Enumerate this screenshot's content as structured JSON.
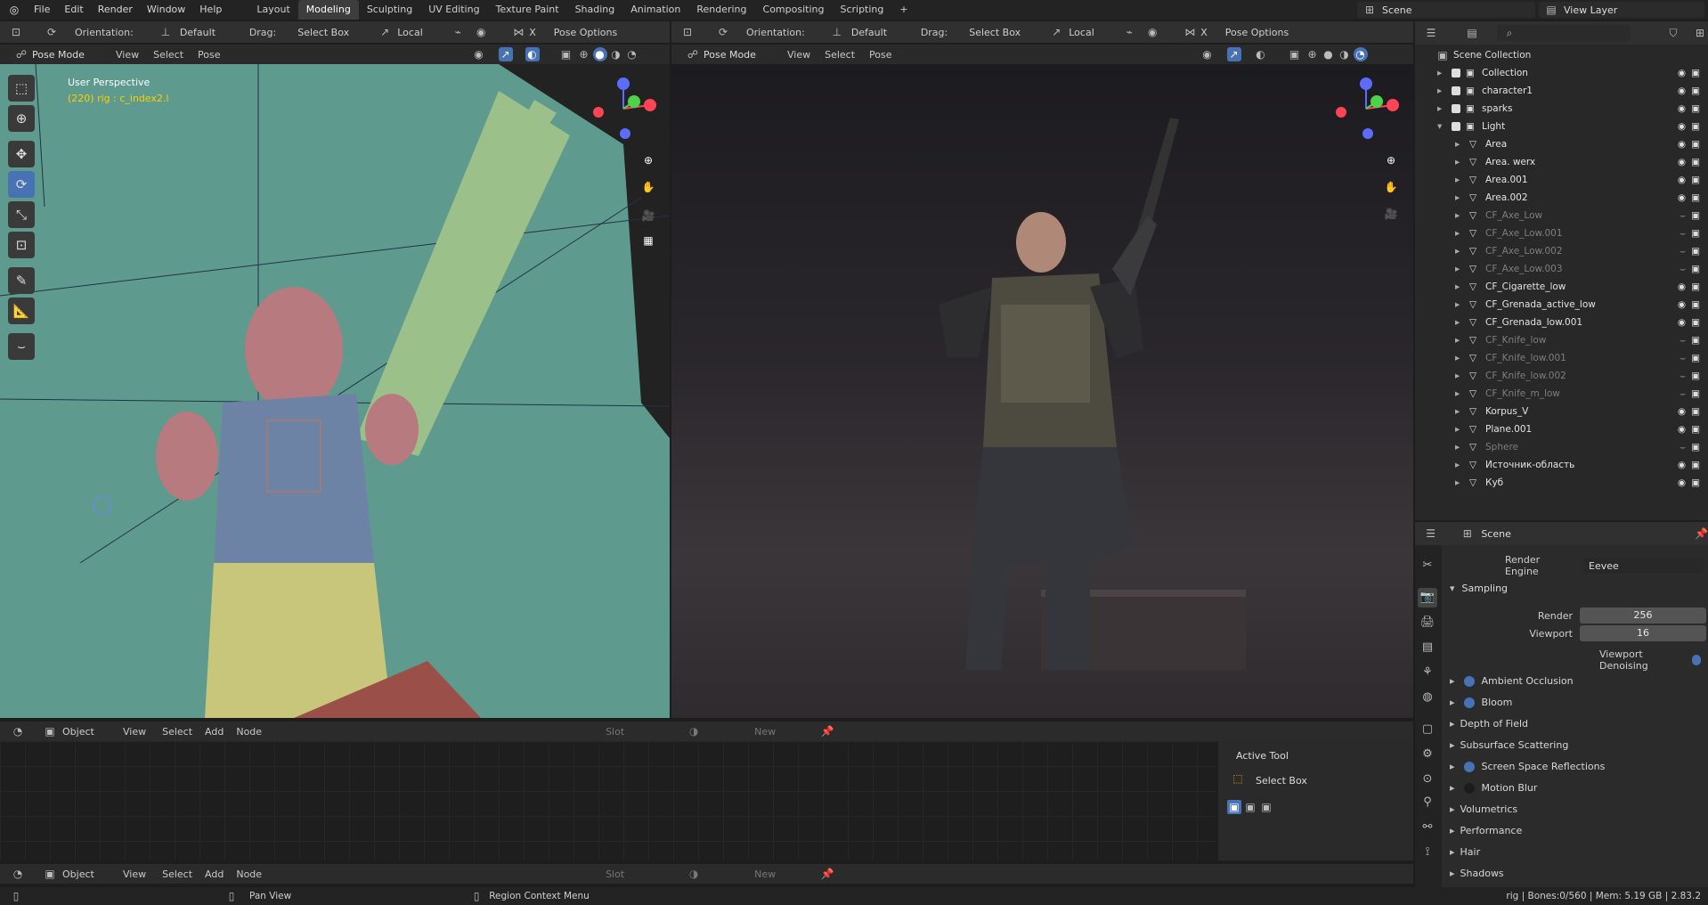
{
  "topbar": {
    "menus": [
      "File",
      "Edit",
      "Render",
      "Window",
      "Help"
    ],
    "workspaces": [
      "Layout",
      "Modeling",
      "Sculpting",
      "UV Editing",
      "Texture Paint",
      "Shading",
      "Animation",
      "Rendering",
      "Compositing",
      "Scripting"
    ],
    "active_workspace": "Modeling",
    "add_tab": "+",
    "scene_label": "Scene",
    "view_layer_label": "View Layer"
  },
  "viewport_header": {
    "orientation_label": "Orientation:",
    "orientation_value": "Default",
    "drag_label": "Drag:",
    "drag_value": "Select Box",
    "transform_value": "Local",
    "axis_label": "X",
    "pose_options": "Pose Options",
    "mode": "Pose Mode",
    "menus": [
      "View",
      "Select",
      "Pose"
    ]
  },
  "left_viewport": {
    "perspective_label": "User Perspective",
    "context_label": "(220) rig : c_index2.l",
    "bg_color": "#5f9a8e"
  },
  "node_editor": {
    "object_label": "Object",
    "menus": [
      "View",
      "Select",
      "Add",
      "Node"
    ],
    "slot_label": "Slot",
    "new_label": "New",
    "active_tool_title": "Active Tool",
    "active_tool_name": "Select Box"
  },
  "outliner": {
    "root": "Scene Collection",
    "items": [
      {
        "name": "Collection",
        "dim": false
      },
      {
        "name": "character1",
        "dim": false
      },
      {
        "name": "sparks",
        "dim": false
      },
      {
        "name": "Light",
        "dim": false
      },
      {
        "name": "Area",
        "dim": false
      },
      {
        "name": "Area. werx",
        "dim": false
      },
      {
        "name": "Area.001",
        "dim": false
      },
      {
        "name": "Area.002",
        "dim": false
      },
      {
        "name": "CF_Axe_Low",
        "dim": true
      },
      {
        "name": "CF_Axe_Low.001",
        "dim": true
      },
      {
        "name": "CF_Axe_Low.002",
        "dim": true
      },
      {
        "name": "CF_Axe_Low.003",
        "dim": true
      },
      {
        "name": "CF_Cigarette_low",
        "dim": false
      },
      {
        "name": "CF_Grenada_active_low",
        "dim": false
      },
      {
        "name": "CF_Grenada_low.001",
        "dim": false
      },
      {
        "name": "CF_Knife_low",
        "dim": true
      },
      {
        "name": "CF_Knife_low.001",
        "dim": true
      },
      {
        "name": "CF_Knife_low.002",
        "dim": true
      },
      {
        "name": "CF_Knife_m_low",
        "dim": true
      },
      {
        "name": "Korpus_V",
        "dim": false
      },
      {
        "name": "Plane.001",
        "dim": false
      },
      {
        "name": "Sphere",
        "dim": true
      },
      {
        "name": "Источник-область",
        "dim": false
      },
      {
        "name": "Куб",
        "dim": false
      }
    ]
  },
  "properties": {
    "context": "Scene",
    "render_engine_label": "Render Engine",
    "render_engine_value": "Eevee",
    "sampling_label": "Sampling",
    "render_label": "Render",
    "render_value": "256",
    "viewport_label": "Viewport",
    "viewport_value": "16",
    "viewport_denoising": "Viewport Denoising",
    "panels": [
      {
        "label": "Ambient Occlusion",
        "toggle": "on"
      },
      {
        "label": "Bloom",
        "toggle": "on"
      },
      {
        "label": "Depth of Field",
        "toggle": "none"
      },
      {
        "label": "Subsurface Scattering",
        "toggle": "none"
      },
      {
        "label": "Screen Space Reflections",
        "toggle": "on"
      },
      {
        "label": "Motion Blur",
        "toggle": "off"
      },
      {
        "label": "Volumetrics",
        "toggle": "none"
      },
      {
        "label": "Performance",
        "toggle": "none"
      },
      {
        "label": "Hair",
        "toggle": "none"
      },
      {
        "label": "Shadows",
        "toggle": "none"
      }
    ]
  },
  "statusbar": {
    "pan_view": "Pan View",
    "region_menu": "Region Context Menu",
    "stats": "rig | Bones:0/560 | Mem: 5.19 GB | 2.83.2"
  }
}
